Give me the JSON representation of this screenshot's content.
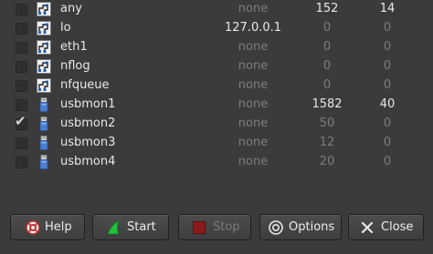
{
  "interfaces": [
    {
      "name": "any",
      "address": "none",
      "packets": "152",
      "packets_per_s": "14",
      "checked": false,
      "icon": "network-interface-icon",
      "active": true
    },
    {
      "name": "lo",
      "address": "127.0.0.1",
      "packets": "0",
      "packets_per_s": "0",
      "checked": false,
      "icon": "network-interface-icon",
      "active": false
    },
    {
      "name": "eth1",
      "address": "none",
      "packets": "0",
      "packets_per_s": "0",
      "checked": false,
      "icon": "network-interface-icon",
      "active": false
    },
    {
      "name": "nflog",
      "address": "none",
      "packets": "0",
      "packets_per_s": "0",
      "checked": false,
      "icon": "network-interface-icon",
      "active": false
    },
    {
      "name": "nfqueue",
      "address": "none",
      "packets": "0",
      "packets_per_s": "0",
      "checked": false,
      "icon": "network-interface-icon",
      "active": false
    },
    {
      "name": "usbmon1",
      "address": "none",
      "packets": "1582",
      "packets_per_s": "40",
      "checked": false,
      "icon": "usb-icon",
      "active": true
    },
    {
      "name": "usbmon2",
      "address": "none",
      "packets": "50",
      "packets_per_s": "0",
      "checked": true,
      "icon": "usb-icon",
      "active": false
    },
    {
      "name": "usbmon3",
      "address": "none",
      "packets": "12",
      "packets_per_s": "0",
      "checked": false,
      "icon": "usb-icon",
      "active": false
    },
    {
      "name": "usbmon4",
      "address": "none",
      "packets": "20",
      "packets_per_s": "0",
      "checked": false,
      "icon": "usb-icon",
      "active": false
    }
  ],
  "buttons": {
    "help": "Help",
    "start": "Start",
    "stop": "Stop",
    "options": "Options",
    "close": "Close"
  },
  "colors": {
    "background": "#3b3b3b",
    "text": "#e8e8e8",
    "dim_text": "#7d7d7d",
    "start_icon": "#22c03c",
    "stop_icon": "#b02020",
    "help_icon": "#c03030"
  }
}
